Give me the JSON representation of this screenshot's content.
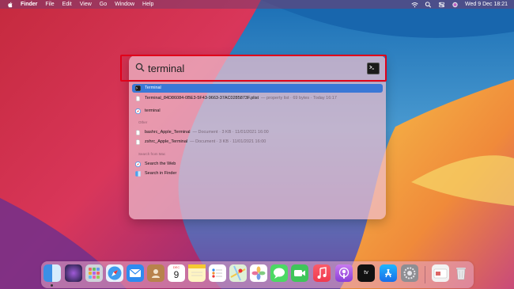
{
  "menubar": {
    "app_name": "Finder",
    "items": [
      "File",
      "Edit",
      "View",
      "Go",
      "Window",
      "Help"
    ],
    "clock": "Wed 9 Dec  18:21"
  },
  "spotlight": {
    "query": "terminal",
    "results": [
      {
        "label": "Terminal",
        "meta": "",
        "selected": true
      },
      {
        "label": "Terminal_84D86084-0BE3-5F43-9663-37AC0285873F.plist",
        "meta": "— property list · 69 bytes · Today 16:17",
        "selected": false
      },
      {
        "label": "terminal",
        "meta": "",
        "selected": false
      }
    ],
    "section_other": "Other",
    "other_results": [
      {
        "label": "bashrc_Apple_Terminal",
        "meta": "— Document · 3 KB · 11/01/2021 16:00"
      },
      {
        "label": "zshrc_Apple_Terminal",
        "meta": "— Document · 3 KB · 11/01/2021 16:00"
      }
    ],
    "section_search": "Search from Mac",
    "search_actions": [
      {
        "label": "Search the Web"
      },
      {
        "label": "Search in Finder"
      }
    ]
  },
  "dock": {
    "calendar_month": "DEC",
    "calendar_day": "9",
    "tv_label": "tv"
  },
  "colors": {
    "selection": "#3a78d6",
    "highlight_box": "#e0001a"
  }
}
